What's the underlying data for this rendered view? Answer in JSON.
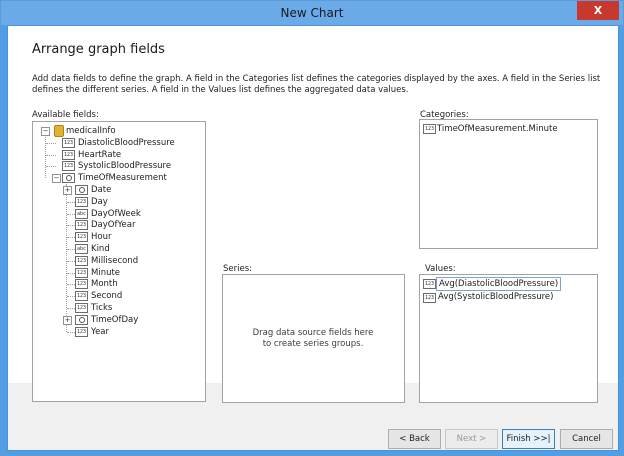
{
  "window": {
    "title": "New Chart",
    "close_symbol": "X"
  },
  "page": {
    "heading": "Arrange graph fields",
    "description": "Add data fields to define the graph. A field in the Categories list defines the categories displayed by the axes. A field in the Series list defines the different series. A field in the Values list defines the aggregated data values."
  },
  "available_fields": {
    "label": "Available fields:",
    "root": "medicalInfo",
    "items": [
      {
        "text": "DiastolicBloodPressure",
        "icon": "numeric-icon",
        "glyph": "123"
      },
      {
        "text": "HeartRate",
        "icon": "numeric-icon",
        "glyph": "123"
      },
      {
        "text": "SystolicBloodPressure",
        "icon": "numeric-icon",
        "glyph": "123"
      },
      {
        "text": "TimeOfMeasurement",
        "icon": "datetime-icon",
        "glyph": ""
      }
    ],
    "children": [
      {
        "text": "Date",
        "icon": "datetime-icon",
        "glyph": "",
        "expandable": true
      },
      {
        "text": "Day",
        "icon": "numeric-icon",
        "glyph": "123"
      },
      {
        "text": "DayOfWeek",
        "icon": "enum-icon",
        "glyph": "abc"
      },
      {
        "text": "DayOfYear",
        "icon": "numeric-icon",
        "glyph": "123"
      },
      {
        "text": "Hour",
        "icon": "numeric-icon",
        "glyph": "123"
      },
      {
        "text": "Kind",
        "icon": "enum-icon",
        "glyph": "abc"
      },
      {
        "text": "Millisecond",
        "icon": "numeric-icon",
        "glyph": "123"
      },
      {
        "text": "Minute",
        "icon": "numeric-icon",
        "glyph": "123"
      },
      {
        "text": "Month",
        "icon": "numeric-icon",
        "glyph": "123"
      },
      {
        "text": "Second",
        "icon": "numeric-icon",
        "glyph": "123"
      },
      {
        "text": "Ticks",
        "icon": "numeric-icon",
        "glyph": "123"
      },
      {
        "text": "TimeOfDay",
        "icon": "timespan-icon",
        "glyph": "",
        "expandable": true
      },
      {
        "text": "Year",
        "icon": "numeric-icon",
        "glyph": "123"
      }
    ]
  },
  "categories": {
    "label": "Categories:",
    "items": [
      {
        "text": "TimeOfMeasurement.Minute",
        "glyph": "123"
      }
    ]
  },
  "series": {
    "label": "Series:",
    "hint_line1": "Drag data source fields here",
    "hint_line2": "to create series groups."
  },
  "values": {
    "label": "Values:",
    "items": [
      {
        "text": "Avg(DiastolicBloodPressure)",
        "glyph": "123",
        "selected": true
      },
      {
        "text": "Avg(SystolicBloodPressure)",
        "glyph": "123",
        "selected": false
      }
    ]
  },
  "buttons": {
    "back": "< Back",
    "next": "Next >",
    "finish": "Finish >>|",
    "cancel": "Cancel"
  },
  "colors": {
    "titlebar": "#6aaae9",
    "close": "#c7392f",
    "panel_bg": "#f0f0f0",
    "content_bg": "#ffffff"
  }
}
